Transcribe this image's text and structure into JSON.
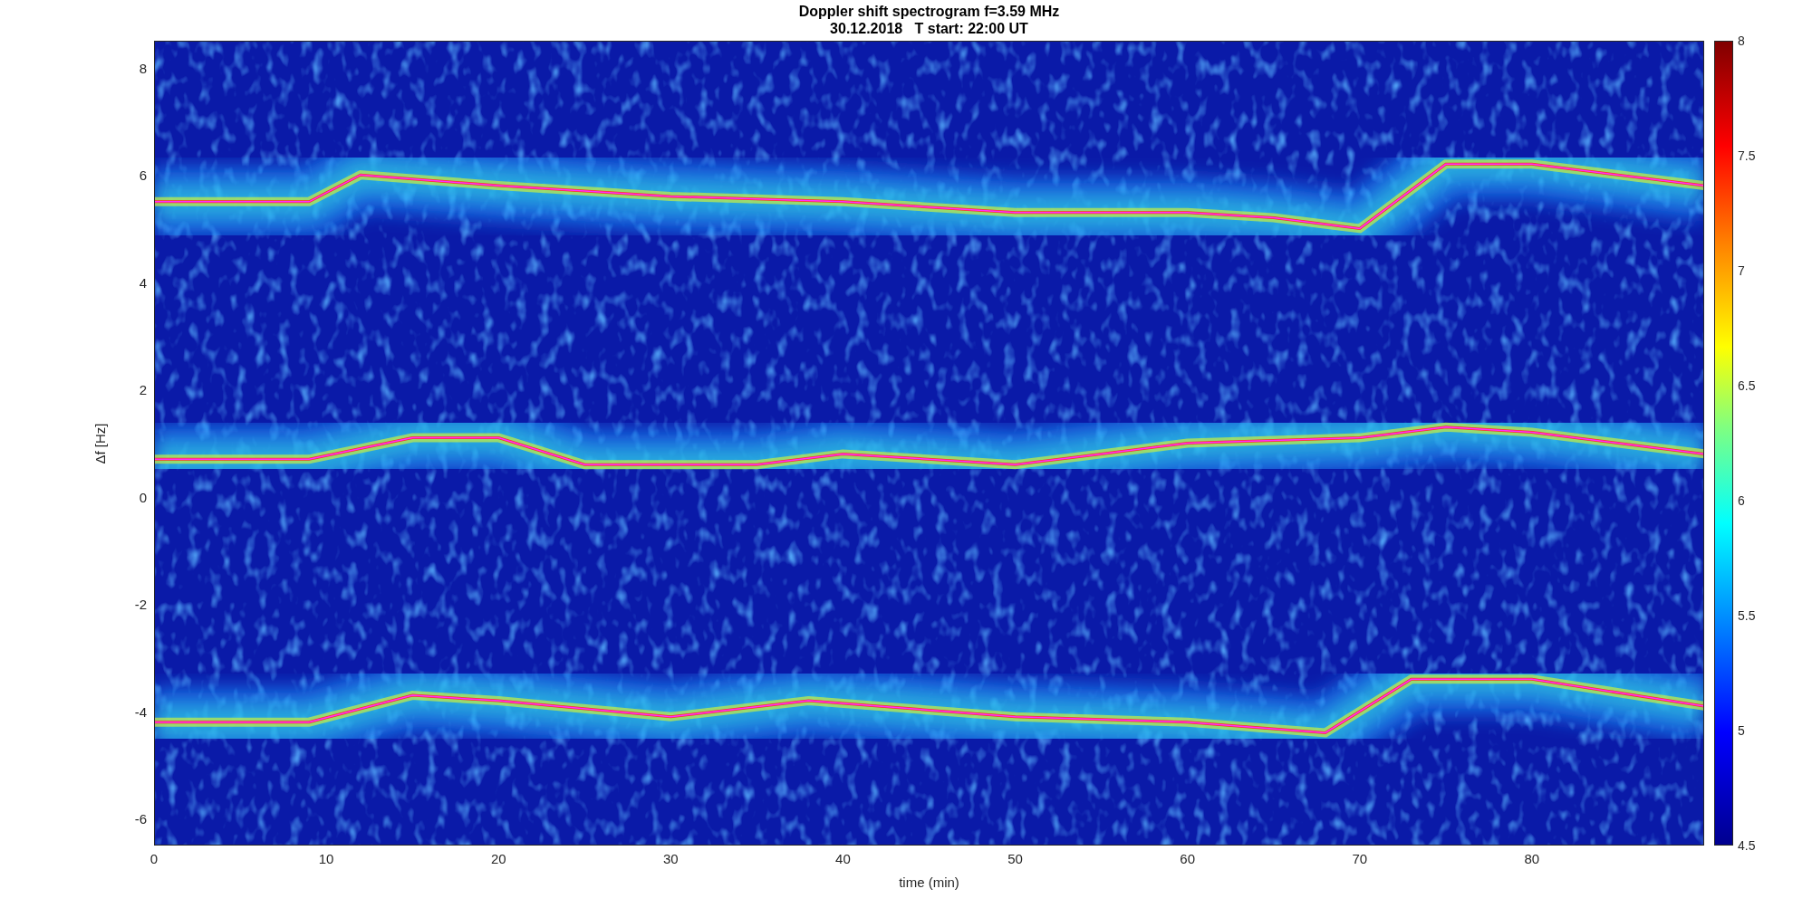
{
  "figure": {
    "title_lines": [
      "Doppler shift spectrogram f=3.59 MHz",
      "30.12.2018   T start: 22:00 UT"
    ]
  },
  "axes": {
    "xlabel": "time (min)",
    "ylabel": "Δf [Hz]",
    "xticks": [
      "0",
      "10",
      "20",
      "30",
      "40",
      "50",
      "60",
      "70",
      "80"
    ],
    "yticks": [
      "8",
      "6",
      "4",
      "2",
      "0",
      "-2",
      "-4",
      "-6"
    ]
  },
  "colorbar": {
    "ticks": [
      "8",
      "7.5",
      "7",
      "6.5",
      "6",
      "5.5",
      "5",
      "4.5"
    ]
  }
}
